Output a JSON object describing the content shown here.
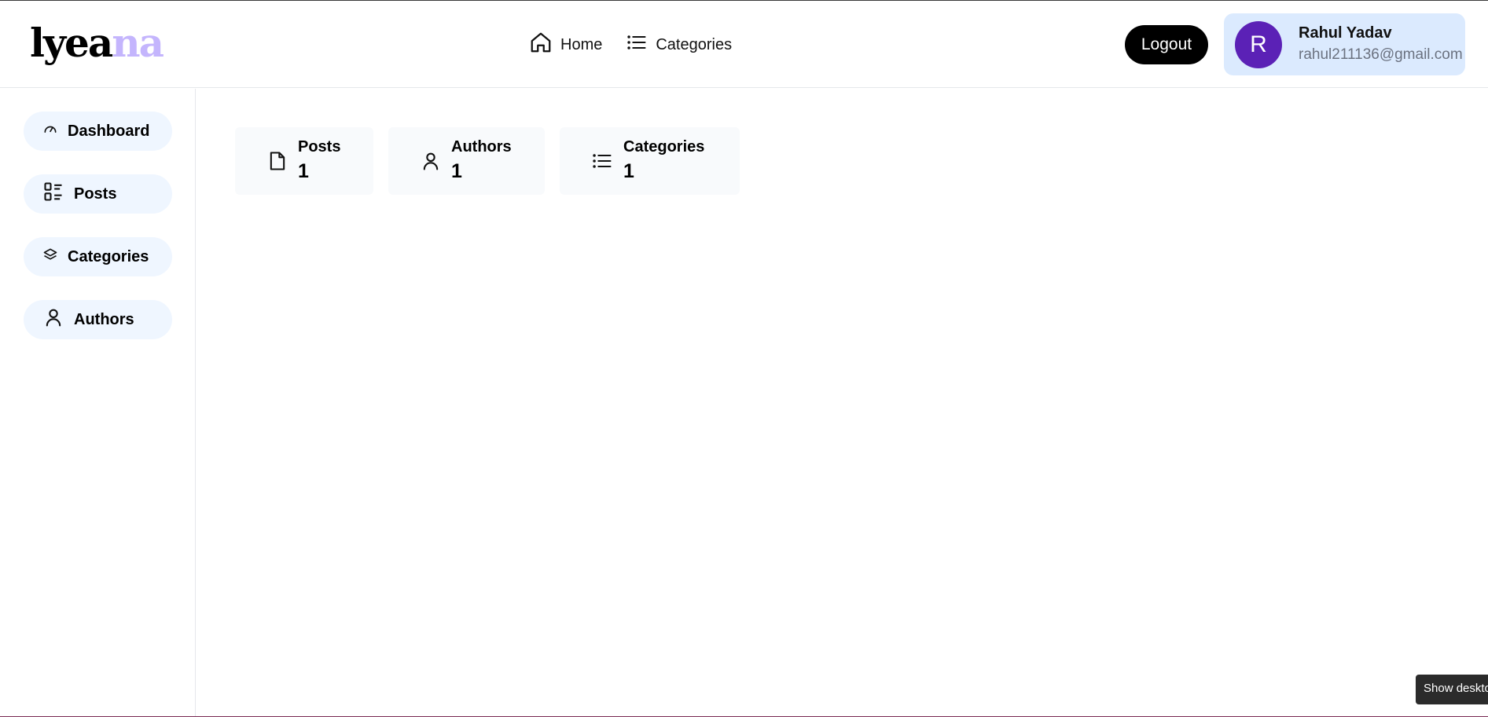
{
  "brand": {
    "logo_dark": "lyea",
    "logo_light": "na",
    "light_color": "#c4b5fd"
  },
  "nav": {
    "home": {
      "label": "Home",
      "icon": "home-icon"
    },
    "categories": {
      "label": "Categories",
      "icon": "list-icon"
    }
  },
  "header": {
    "logout_label": "Logout",
    "user": {
      "initial": "R",
      "name": "Rahul Yadav",
      "email": "rahul211136@gmail.com",
      "avatar_color": "#5b21b6",
      "card_color": "#dbeafe"
    }
  },
  "sidebar": {
    "items": [
      {
        "label": "Dashboard",
        "icon": "gauge-icon"
      },
      {
        "label": "Posts",
        "icon": "list-detail-icon"
      },
      {
        "label": "Categories",
        "icon": "layers-icon"
      },
      {
        "label": "Authors",
        "icon": "user-icon"
      }
    ]
  },
  "stats": [
    {
      "label": "Posts",
      "value": "1",
      "icon": "file-icon"
    },
    {
      "label": "Authors",
      "value": "1",
      "icon": "user-icon"
    },
    {
      "label": "Categories",
      "value": "1",
      "icon": "list-icon"
    }
  ],
  "tooltip": {
    "text": "Show desktop"
  }
}
